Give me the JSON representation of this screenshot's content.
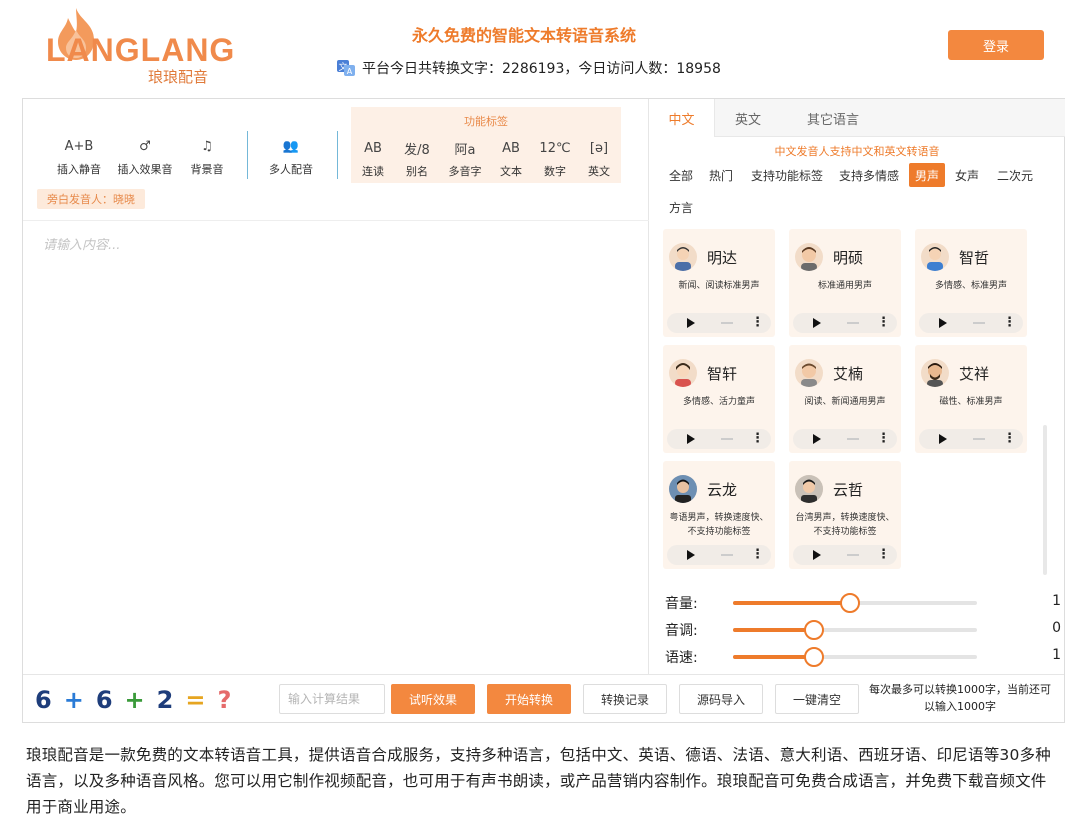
{
  "header": {
    "logo_text": "LANGLANG",
    "logo_sub": "琅琅配音",
    "site_title": "永久免费的智能文本转语音系统",
    "stats_text": "平台今日共转换文字：2286193，今日访问人数：18958",
    "login_label": "登录"
  },
  "toolbar": {
    "tools": [
      {
        "icon": "A+B",
        "label": "插入静音"
      },
      {
        "icon": "♂",
        "label": "插入效果音"
      },
      {
        "icon": "♫",
        "label": "背景音"
      },
      {
        "icon": "👥",
        "label": "多人配音"
      }
    ],
    "feature_title": "功能标签",
    "features": [
      {
        "icon": "AB",
        "label": "连读"
      },
      {
        "icon": "发/8",
        "label": "别名"
      },
      {
        "icon": "阿a",
        "label": "多音字"
      },
      {
        "icon": "AB",
        "label": "文本"
      },
      {
        "icon": "12℃",
        "label": "数字"
      },
      {
        "icon": "[ə]",
        "label": "英文"
      }
    ],
    "narrator": "旁白发音人：晓晓"
  },
  "editor": {
    "placeholder": "请输入内容..."
  },
  "right": {
    "lang_tabs": [
      "中文",
      "英文",
      "其它语言"
    ],
    "voice_hint": "中文发音人支持中文和英文转语音",
    "filters": [
      "全部",
      "热门",
      "支持功能标签",
      "支持多情感",
      "男声",
      "女声",
      "二次元",
      "方言"
    ],
    "active_filter": "男声",
    "voices": [
      {
        "name": "明达",
        "desc": "新闻、阅读标准男声"
      },
      {
        "name": "明硕",
        "desc": "标准通用男声"
      },
      {
        "name": "智哲",
        "desc": "多情感、标准男声"
      },
      {
        "name": "智轩",
        "desc": "多情感、活力童声"
      },
      {
        "name": "艾楠",
        "desc": "阅读、新闻通用男声"
      },
      {
        "name": "艾祥",
        "desc": "磁性、标准男声"
      },
      {
        "name": "云龙",
        "desc": "粤语男声，转换速度快、不支持功能标签"
      },
      {
        "name": "云哲",
        "desc": "台湾男声，转换速度快、不支持功能标签"
      }
    ],
    "sliders": [
      {
        "label": "音量:",
        "value": "1",
        "fraction": 0.48
      },
      {
        "label": "音调:",
        "value": "0",
        "fraction": 0.33
      },
      {
        "label": "语速:",
        "value": "1",
        "fraction": 0.33
      }
    ]
  },
  "bottom": {
    "captcha": [
      "6",
      "+",
      "6",
      "+",
      "2",
      "=",
      "?"
    ],
    "calc_placeholder": "输入计算结果",
    "buttons": [
      "试听效果",
      "开始转换",
      "转换记录",
      "源码导入",
      "一键清空"
    ],
    "limit_note": "每次最多可以转换1000字，当前还可以输入1000字"
  },
  "description": "琅琅配音是一款免费的文本转语音工具，提供语音合成服务，支持多种语言，包括中文、英语、德语、法语、意大利语、西班牙语、印尼语等30多种语言，以及多种语音风格。您可以用它制作视频配音，也可用于有声书朗读，或产品营销内容制作。琅琅配音可免费合成语言，并免费下载音频文件用于商业用途。",
  "colors": {
    "accent": "#ee7b2b",
    "accent_light": "#fdf0e6"
  }
}
